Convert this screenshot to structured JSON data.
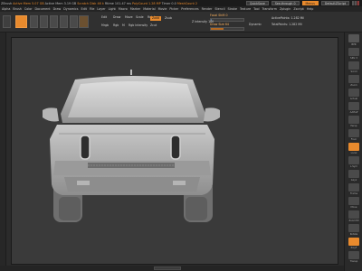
{
  "app": {
    "title_bar": {
      "tabs": [
        "ZBrush",
        "Active Mem 5.07 GB",
        "Active Mem 3.19 GB",
        "Scratch Disk 46 k",
        "Rtime 101.47 ms",
        "PolyCount 1.28 MP",
        "Timer 0.0",
        "MeshCount 2"
      ],
      "quicksave": "QuickSave",
      "see_through": "See-through 0",
      "menus": "Menus",
      "default_script": "DefaultZScript"
    },
    "menu_bar": {
      "items": [
        "Alpha",
        "Brush",
        "Color",
        "Document",
        "Draw",
        "Dynamics",
        "Edit",
        "File",
        "Layer",
        "Light",
        "Macro",
        "Marker",
        "Material",
        "Movie",
        "Picker",
        "Preferences",
        "Render",
        "Stencil",
        "Stroke",
        "Texture",
        "Tool",
        "Transform",
        "Zplugin",
        "Zscript",
        "Help"
      ]
    },
    "shelf": {
      "edit_label": "Edit",
      "draw_label": "Draw",
      "move_label": "Move",
      "scale_label": "Scale",
      "rotate_label": "Rotate",
      "mrgb_label": "Mrgb",
      "rgb_label": "Rgb",
      "m_label": "M",
      "rgb_intensity_label": "Rgb Intensity",
      "zadd_label": "Zadd",
      "zsub_label": "Zsub",
      "zcut_label": "Zcut",
      "focal_shift_label": "Focal Shift 0",
      "draw_size_label": "Draw Size 64",
      "z_intensity_label": "Z Intensity 100",
      "dynamic_label": "Dynamic",
      "active_points_label": "ActivePoints: 1.282 Mil",
      "total_points_label": "TotalPoints: 1.282 Mil"
    },
    "right_shelf": {
      "buttons": [
        {
          "name": "bpr",
          "label": "BPR"
        },
        {
          "name": "spix",
          "label": "SPix 3"
        },
        {
          "name": "scroll",
          "label": "Scroll"
        },
        {
          "name": "zoom",
          "label": "Zoom"
        },
        {
          "name": "actual",
          "label": "Actual"
        },
        {
          "name": "aahalf",
          "label": "AAHalf"
        },
        {
          "name": "persp",
          "label": "Persp"
        },
        {
          "name": "floor",
          "label": "Floor"
        },
        {
          "name": "local",
          "label": "Local"
        },
        {
          "name": "lsym",
          "label": "L.Sym"
        },
        {
          "name": "gxyz",
          "label": "Gxyz"
        },
        {
          "name": "frame",
          "label": "Frame"
        },
        {
          "name": "move",
          "label": "Move"
        },
        {
          "name": "zoom3d",
          "label": "Zoom3D"
        },
        {
          "name": "rotate",
          "label": "Rotate"
        },
        {
          "name": "polyf",
          "label": "PolyF"
        },
        {
          "name": "transp",
          "label": "Transp"
        },
        {
          "name": "solo",
          "label": "Solo"
        },
        {
          "name": "xpose",
          "label": "Xpose"
        }
      ]
    },
    "colors": {
      "accent": "#e88a2d",
      "canvas_bg": "#3a3a3a",
      "ui_bg": "#2b2b2b"
    }
  }
}
